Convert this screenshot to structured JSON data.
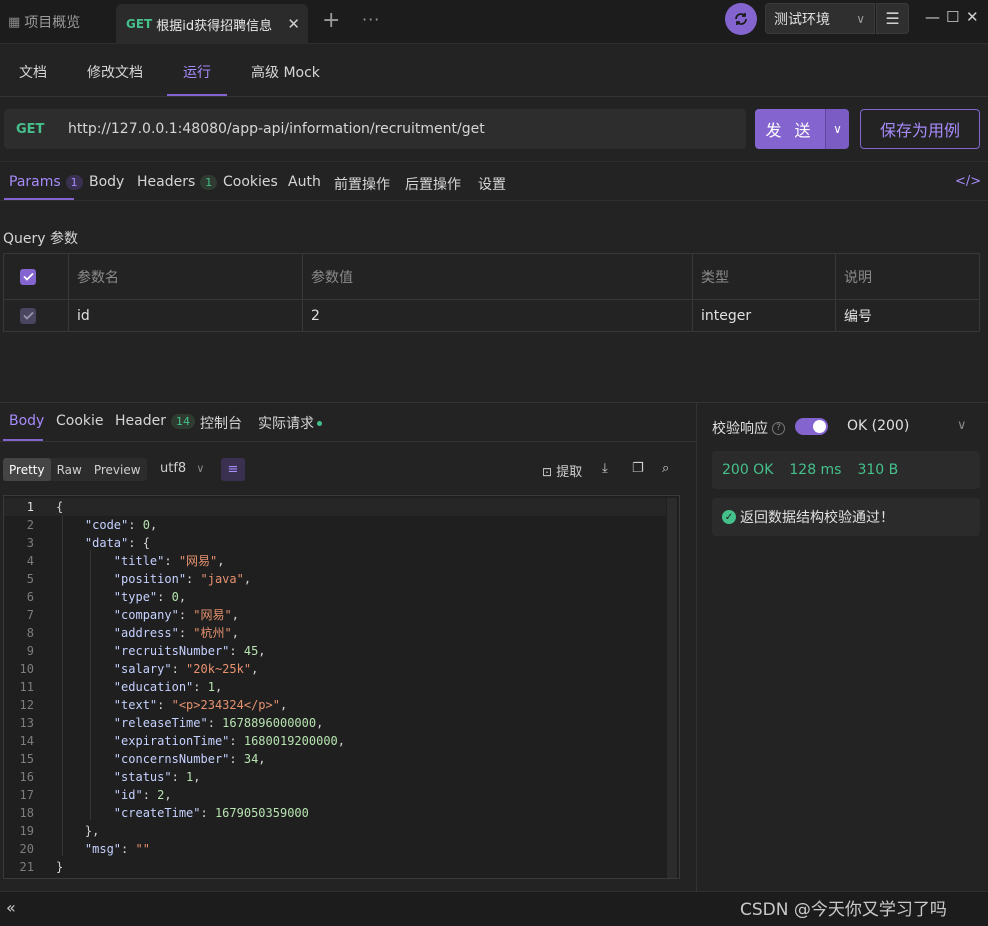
{
  "titlebar": {
    "home_tab": "项目概览",
    "active_tab_method": "GET",
    "active_tab_title": "根据id获得招聘信息",
    "env": "测试环境"
  },
  "doc_tabs": [
    "文档",
    "修改文档",
    "运行",
    "高级 Mock"
  ],
  "request": {
    "method": "GET",
    "url": "http://127.0.0.1:48080/app-api/information/recruitment/get",
    "send_label": "发 送",
    "save_label": "保存为用例"
  },
  "req_tabs": {
    "params": "Params",
    "params_count": "1",
    "body": "Body",
    "headers": "Headers",
    "headers_count": "1",
    "cookies": "Cookies",
    "auth": "Auth",
    "pre": "前置操作",
    "post": "后置操作",
    "settings": "设置"
  },
  "query": {
    "label": "Query 参数",
    "headers": [
      "参数名",
      "参数值",
      "类型",
      "说明"
    ],
    "rows": [
      {
        "name": "id",
        "value": "2",
        "type": "integer",
        "desc": "编号"
      }
    ]
  },
  "response": {
    "tabs": {
      "body": "Body",
      "cookie": "Cookie",
      "header": "Header",
      "header_count": "14",
      "console": "控制台",
      "actual": "实际请求"
    },
    "view_modes": [
      "Pretty",
      "Raw",
      "Preview"
    ],
    "encoding": "utf8",
    "extract": "提取",
    "validate_label": "校验响应",
    "status_select": "OK (200)",
    "status": "200 OK",
    "time": "128 ms",
    "size": "310 B",
    "verify_msg": "返回数据结构校验通过！"
  },
  "code_lines": [
    "{",
    "    \"code\": 0,",
    "    \"data\": {",
    "        \"title\": \"网易\",",
    "        \"position\": \"java\",",
    "        \"type\": 0,",
    "        \"company\": \"网易\",",
    "        \"address\": \"杭州\",",
    "        \"recruitsNumber\": 45,",
    "        \"salary\": \"20k~25k\",",
    "        \"education\": 1,",
    "        \"text\": \"<p>234324</p>\",",
    "        \"releaseTime\": 1678896000000,",
    "        \"expirationTime\": 1680019200000,",
    "        \"concernsNumber\": 34,",
    "        \"status\": 1,",
    "        \"id\": 2,",
    "        \"createTime\": 1679050359000",
    "    },",
    "    \"msg\": \"\"",
    "}"
  ],
  "watermark": "CSDN @今天你又学习了吗",
  "colors": {
    "accent": "#8465d0",
    "success": "#45c08b",
    "background": "#232323"
  }
}
